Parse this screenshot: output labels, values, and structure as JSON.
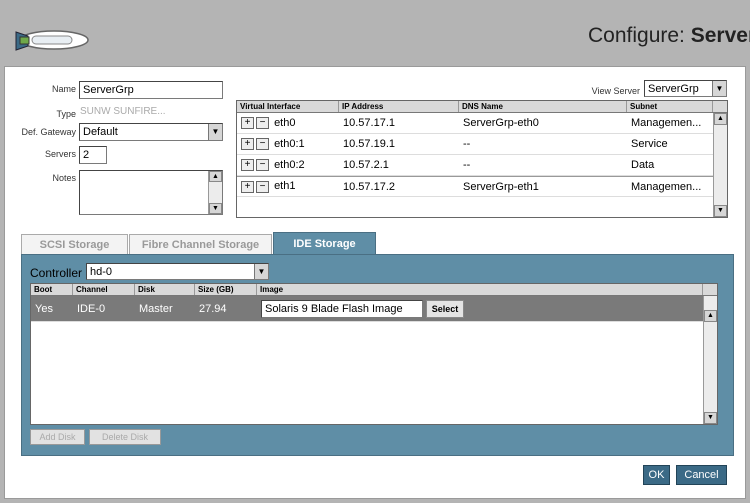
{
  "header": {
    "title_prefix": "Configure: ",
    "title_strong": "Server"
  },
  "form": {
    "name_label": "Name",
    "name_value": "ServerGrp",
    "type_label": "Type",
    "type_value": "SUNW SUNFIRE...",
    "gateway_label": "Def. Gateway",
    "gateway_value": "Default",
    "servers_label": "Servers",
    "servers_value": "2",
    "notes_label": "Notes",
    "notes_value": ""
  },
  "view_server": {
    "label": "View Server",
    "value": "ServerGrp"
  },
  "interfaces": {
    "columns": [
      "Virtual Interface",
      "IP Address",
      "DNS Name",
      "Subnet"
    ],
    "rows": [
      {
        "iface": "eth0",
        "ip": "10.57.17.1",
        "dns": "ServerGrp-eth0",
        "subnet": "Managemen..."
      },
      {
        "iface": "eth0:1",
        "ip": "10.57.19.1",
        "dns": "--",
        "subnet": "Service"
      },
      {
        "iface": "eth0:2",
        "ip": "10.57.2.1",
        "dns": "--",
        "subnet": "Data"
      },
      {
        "iface": "eth1",
        "ip": "10.57.17.2",
        "dns": "ServerGrp-eth1",
        "subnet": "Managemen..."
      }
    ]
  },
  "tabs": [
    {
      "label": "SCSI Storage"
    },
    {
      "label": "Fibre Channel Storage"
    },
    {
      "label": "IDE Storage"
    }
  ],
  "storage": {
    "controller_label": "Controller",
    "controller_value": "hd-0",
    "columns": [
      "Boot",
      "Channel",
      "Disk",
      "Size (GB)",
      "Image"
    ],
    "rows": [
      {
        "boot": "Yes",
        "channel": "IDE-0",
        "disk": "Master",
        "size": "27.94",
        "image": "Solaris 9 Blade Flash Image",
        "select_label": "Select"
      }
    ],
    "add_disk_label": "Add Disk",
    "delete_disk_label": "Delete Disk"
  },
  "actions": {
    "ok_label": "OK",
    "cancel_label": "Cancel"
  }
}
